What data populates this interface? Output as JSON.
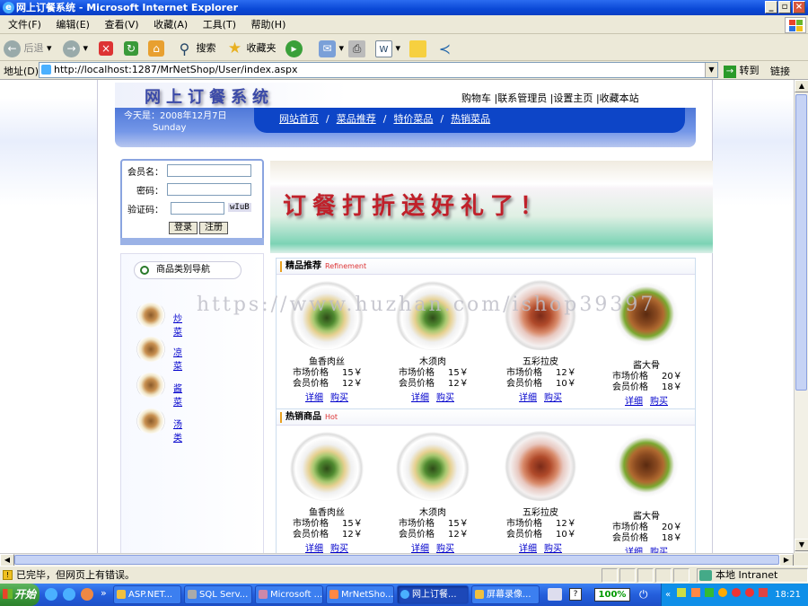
{
  "window": {
    "title": "网上订餐系统 - Microsoft Internet Explorer"
  },
  "menu": [
    "文件(F)",
    "编辑(E)",
    "查看(V)",
    "收藏(A)",
    "工具(T)",
    "帮助(H)"
  ],
  "toolbar": {
    "back": "后退",
    "search": "搜索",
    "favorites": "收藏夹"
  },
  "address": {
    "label": "地址(D)",
    "url": "http://localhost:1287/MrNetShop/User/index.aspx",
    "go": "转到",
    "links": "链接"
  },
  "site": {
    "title": "网上订餐系统",
    "topnav": [
      "购物车",
      "|联系管理员",
      "|设置主页",
      "|收藏本站"
    ],
    "date": "今天是：2008年12月7日",
    "weekday": "Sunday",
    "nav": [
      "网站首页",
      "菜品推荐",
      "特价菜品",
      "热销菜品"
    ],
    "nav_sep": "/"
  },
  "login": {
    "member_label": "会员名：",
    "password_label": "密码：",
    "captcha_label": "验证码：",
    "captcha_code": "wIuB",
    "login_btn": "登录",
    "register_btn": "注册"
  },
  "categories": {
    "header": "商品类别导航",
    "items": [
      "炒菜",
      "凉菜",
      "酱菜",
      "汤类"
    ]
  },
  "promo": {
    "text": "订餐打折送好礼了！"
  },
  "sections": [
    {
      "title": "精品推荐",
      "en": "Refinement",
      "products": [
        {
          "name": "鱼香肉丝",
          "market_label": "市场价格",
          "market": "15￥",
          "member_label": "会员价格",
          "member": "12￥",
          "detail": "详细",
          "buy": "购买"
        },
        {
          "name": "木须肉",
          "market_label": "市场价格",
          "market": "15￥",
          "member_label": "会员价格",
          "member": "12￥",
          "detail": "详细",
          "buy": "购买"
        },
        {
          "name": "五彩拉皮",
          "market_label": "市场价格",
          "market": "12￥",
          "member_label": "会员价格",
          "member": "10￥",
          "detail": "详细",
          "buy": "购买"
        },
        {
          "name": "酱大骨",
          "market_label": "市场价格",
          "market": "20￥",
          "member_label": "会员价格",
          "member": "18￥",
          "detail": "详细",
          "buy": "购买"
        }
      ]
    },
    {
      "title": "热销商品",
      "en": "Hot",
      "products": [
        {
          "name": "鱼香肉丝",
          "market_label": "市场价格",
          "market": "15￥",
          "member_label": "会员价格",
          "member": "12￥",
          "detail": "详细",
          "buy": "购买"
        },
        {
          "name": "木须肉",
          "market_label": "市场价格",
          "market": "15￥",
          "member_label": "会员价格",
          "member": "12￥",
          "detail": "详细",
          "buy": "购买"
        },
        {
          "name": "五彩拉皮",
          "market_label": "市场价格",
          "market": "12￥",
          "member_label": "会员价格",
          "member": "10￥",
          "detail": "详细",
          "buy": "购买"
        },
        {
          "name": "酱大骨",
          "market_label": "市场价格",
          "market": "20￥",
          "member_label": "会员价格",
          "member": "18￥",
          "detail": "详细",
          "buy": "购买"
        }
      ]
    }
  ],
  "watermark": "https://www.huzhan.com/ishop39397",
  "status": {
    "text": "已完毕，但网页上有错误。",
    "zone": "本地 Intranet"
  },
  "taskbar": {
    "start": "开始",
    "tasks": [
      "ASP.NET...",
      "SQL Serv...",
      "Microsoft ...",
      "MrNetSho...",
      "网上订餐...",
      "屏幕录像..."
    ],
    "zoom": "100%",
    "clock": "18:21"
  }
}
